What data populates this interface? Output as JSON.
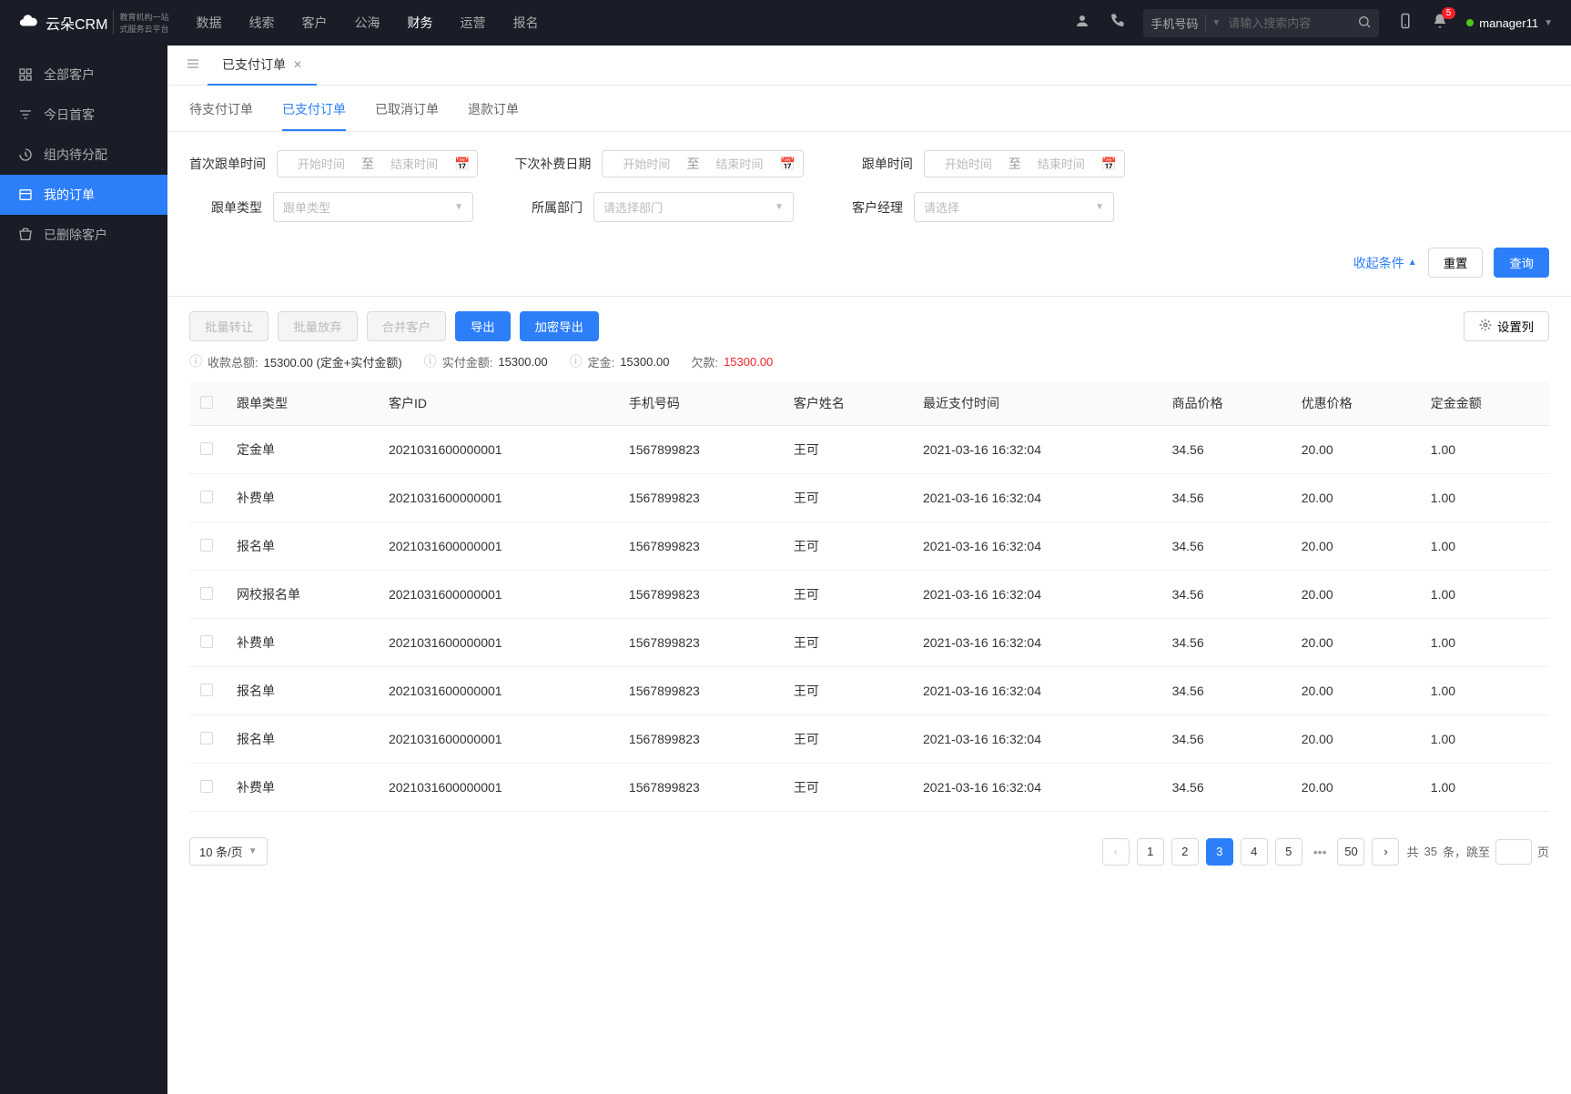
{
  "header": {
    "logo_main": "云朵CRM",
    "logo_sub1": "教育机构一站",
    "logo_sub2": "式服务云平台",
    "nav": [
      "数据",
      "线索",
      "客户",
      "公海",
      "财务",
      "运营",
      "报名"
    ],
    "nav_active": 4,
    "search_type": "手机号码",
    "search_placeholder": "请输入搜索内容",
    "notification_count": "5",
    "user_name": "manager11"
  },
  "sidebar": {
    "items": [
      {
        "label": "全部客户"
      },
      {
        "label": "今日首客"
      },
      {
        "label": "组内待分配"
      },
      {
        "label": "我的订单"
      },
      {
        "label": "已删除客户"
      }
    ],
    "active": 3
  },
  "tabs": {
    "items": [
      {
        "label": "已支付订单"
      }
    ]
  },
  "sub_tabs": {
    "items": [
      "待支付订单",
      "已支付订单",
      "已取消订单",
      "退款订单"
    ],
    "active": 1
  },
  "filters": {
    "first_follow_label": "首次跟单时间",
    "next_pay_label": "下次补费日期",
    "follow_time_label": "跟单时间",
    "follow_type_label": "跟单类型",
    "department_label": "所属部门",
    "manager_label": "客户经理",
    "start_placeholder": "开始时间",
    "end_placeholder": "结束时间",
    "to_label": "至",
    "follow_type_placeholder": "跟单类型",
    "department_placeholder": "请选择部门",
    "manager_placeholder": "请选择",
    "collapse_label": "收起条件",
    "reset_label": "重置",
    "search_label": "查询"
  },
  "toolbar": {
    "batch_transfer": "批量转让",
    "batch_giveup": "批量放弃",
    "merge": "合并客户",
    "export": "导出",
    "encrypt_export": "加密导出",
    "column_settings": "设置列"
  },
  "summary": {
    "total_label": "收款总额:",
    "total_value": "15300.00 (定金+实付金额)",
    "actual_label": "实付金额:",
    "actual_value": "15300.00",
    "deposit_label": "定金:",
    "deposit_value": "15300.00",
    "debt_label": "欠款:",
    "debt_value": "15300.00"
  },
  "table": {
    "headers": [
      "跟单类型",
      "客户ID",
      "手机号码",
      "客户姓名",
      "最近支付时间",
      "商品价格",
      "优惠价格",
      "定金金额"
    ],
    "rows": [
      {
        "type": "定金单",
        "id": "2021031600000001",
        "phone": "1567899823",
        "name": "王可",
        "time": "2021-03-16 16:32:04",
        "price": "34.56",
        "discount": "20.00",
        "deposit": "1.00"
      },
      {
        "type": "补费单",
        "id": "2021031600000001",
        "phone": "1567899823",
        "name": "王可",
        "time": "2021-03-16 16:32:04",
        "price": "34.56",
        "discount": "20.00",
        "deposit": "1.00"
      },
      {
        "type": "报名单",
        "id": "2021031600000001",
        "phone": "1567899823",
        "name": "王可",
        "time": "2021-03-16 16:32:04",
        "price": "34.56",
        "discount": "20.00",
        "deposit": "1.00"
      },
      {
        "type": "网校报名单",
        "id": "2021031600000001",
        "phone": "1567899823",
        "name": "王可",
        "time": "2021-03-16 16:32:04",
        "price": "34.56",
        "discount": "20.00",
        "deposit": "1.00"
      },
      {
        "type": "补费单",
        "id": "2021031600000001",
        "phone": "1567899823",
        "name": "王可",
        "time": "2021-03-16 16:32:04",
        "price": "34.56",
        "discount": "20.00",
        "deposit": "1.00"
      },
      {
        "type": "报名单",
        "id": "2021031600000001",
        "phone": "1567899823",
        "name": "王可",
        "time": "2021-03-16 16:32:04",
        "price": "34.56",
        "discount": "20.00",
        "deposit": "1.00"
      },
      {
        "type": "报名单",
        "id": "2021031600000001",
        "phone": "1567899823",
        "name": "王可",
        "time": "2021-03-16 16:32:04",
        "price": "34.56",
        "discount": "20.00",
        "deposit": "1.00"
      },
      {
        "type": "补费单",
        "id": "2021031600000001",
        "phone": "1567899823",
        "name": "王可",
        "time": "2021-03-16 16:32:04",
        "price": "34.56",
        "discount": "20.00",
        "deposit": "1.00"
      }
    ]
  },
  "pagination": {
    "page_size_label": "10 条/页",
    "pages": [
      "1",
      "2",
      "3",
      "4",
      "5"
    ],
    "last_page": "50",
    "active": 2,
    "total_prefix": "共 ",
    "total_count": "35",
    "total_suffix": " 条，跳至",
    "page_suffix": "页"
  }
}
